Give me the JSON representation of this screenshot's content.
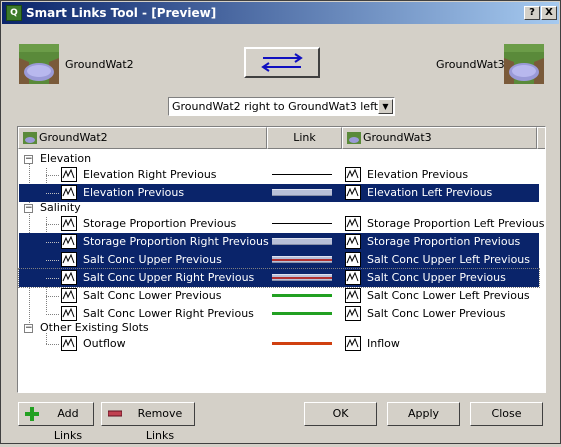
{
  "window": {
    "title": "Smart Links Tool - [Preview]",
    "help_label": "?",
    "close_label": "X",
    "app_icon_text": "Q"
  },
  "source": {
    "name": "GroundWat2"
  },
  "target": {
    "name": "GroundWat3"
  },
  "swap_icon": "swap-arrows-icon",
  "direction_select": {
    "value": "GroundWat2 right to GroundWat3 left"
  },
  "columns": {
    "left": "GroundWat2",
    "link": "Link",
    "right": "GroundWat3"
  },
  "colors": {
    "selection": "#0a246a",
    "link_black": "#000000",
    "link_lavender": "#b8c0d8",
    "link_red": "#b03030",
    "link_green": "#22a022",
    "link_orange": "#d04010"
  },
  "groups": [
    {
      "label": "Elevation",
      "rows": [
        {
          "left": "Elevation Right Previous",
          "right": "Elevation Previous",
          "link": "black",
          "selected": false
        },
        {
          "left": "Elevation Previous",
          "right": "Elevation Left Previous",
          "link": "lavender",
          "selected": true
        }
      ]
    },
    {
      "label": "Salinity",
      "rows": [
        {
          "left": "Storage Proportion Previous",
          "right": "Storage Proportion Left Previous",
          "link": "black",
          "selected": false
        },
        {
          "left": "Storage Proportion Right Previous",
          "right": "Storage Proportion Previous",
          "link": "lavender",
          "selected": true
        },
        {
          "left": "Salt Conc Upper Previous",
          "right": "Salt Conc Upper Left Previous",
          "link": "red",
          "selected": true
        },
        {
          "left": "Salt Conc Upper Right Previous",
          "right": "Salt Conc Upper Previous",
          "link": "red",
          "selected": true
        },
        {
          "left": "Salt Conc Lower Previous",
          "right": "Salt Conc Lower Left Previous",
          "link": "green",
          "selected": false
        },
        {
          "left": "Salt Conc Lower Right Previous",
          "right": "Salt Conc Lower Previous",
          "link": "green",
          "selected": false
        }
      ]
    },
    {
      "label": "Other Existing Slots",
      "rows": [
        {
          "left": "Outflow",
          "right": "Inflow",
          "link": "orange",
          "selected": false
        }
      ]
    }
  ],
  "buttons": {
    "add_links": "Add Links",
    "remove_links": "Remove Links",
    "ok": "OK",
    "apply": "Apply",
    "close": "Close"
  }
}
